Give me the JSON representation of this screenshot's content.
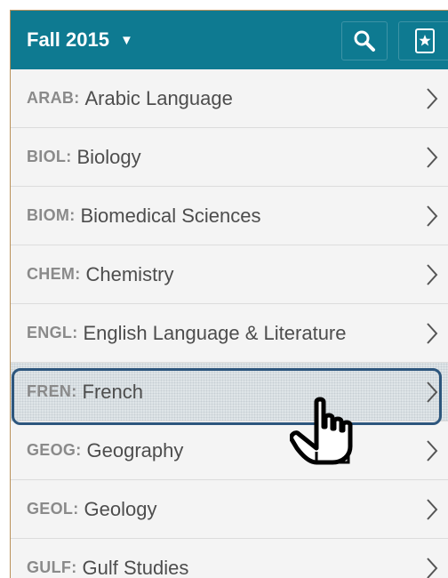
{
  "header": {
    "term_label": "Fall 2015",
    "term_caret_icon": "caret-down-icon",
    "search_icon": "search-icon",
    "bookmark_icon": "bookmark-star-icon",
    "bg_color": "#0e7a91"
  },
  "subjects": [
    {
      "code": "ARAB:",
      "name": "Arabic Language"
    },
    {
      "code": "BIOL:",
      "name": "Biology"
    },
    {
      "code": "BIOM:",
      "name": "Biomedical Sciences"
    },
    {
      "code": "CHEM:",
      "name": "Chemistry"
    },
    {
      "code": "ENGL:",
      "name": "English Language & Literature"
    },
    {
      "code": "FREN:",
      "name": "French"
    },
    {
      "code": "GEOG:",
      "name": "Geography"
    },
    {
      "code": "GEOL:",
      "name": "Geology"
    },
    {
      "code": "GULF:",
      "name": "Gulf Studies"
    }
  ],
  "selected_subject": "FREN:",
  "highlight_color": "#2d567d",
  "row_chevron_icon": "chevron-right-icon",
  "pointer_icon": "hand-pointer-icon"
}
